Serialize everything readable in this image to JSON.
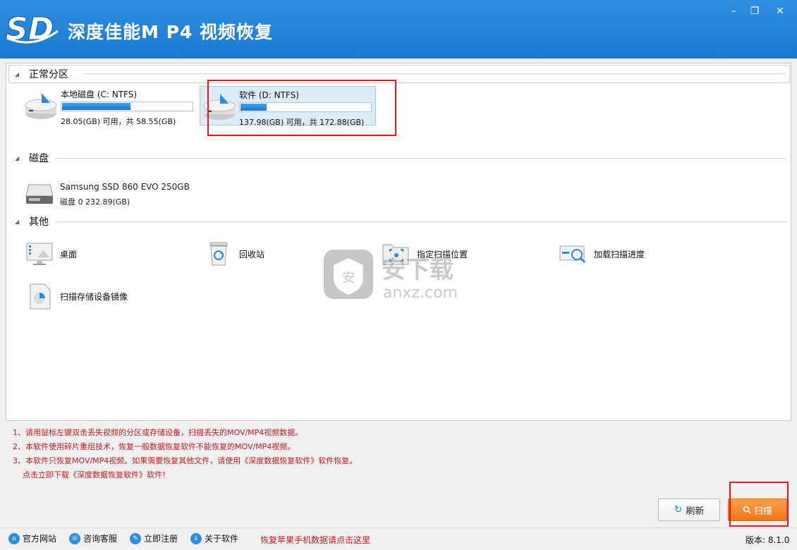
{
  "app": {
    "title": "深度佳能M P4 视频恢复",
    "logo_text": "SD"
  },
  "window_controls": {
    "minimize": "–",
    "restore": "❐",
    "close": "✕"
  },
  "sections": {
    "partitions": {
      "label": "正常分区",
      "items": [
        {
          "name": "本地磁盘 (C: NTFS)",
          "usage": "28.05(GB) 可用，共 58.55(GB)",
          "used_fraction": 0.52,
          "selected": false
        },
        {
          "name": "软件 (D: NTFS)",
          "usage": "137.98(GB) 可用，共 172.88(GB)",
          "used_fraction": 0.2,
          "selected": true
        }
      ]
    },
    "disks": {
      "label": "磁盘",
      "items": [
        {
          "name": "Samsung SSD 860 EVO 250GB",
          "info": "磁盘 0    232.89(GB)"
        }
      ]
    },
    "others": {
      "label": "其他",
      "items": [
        {
          "label": "桌面",
          "icon": "desktop-icon"
        },
        {
          "label": "回收站",
          "icon": "recycle-bin-icon"
        },
        {
          "label": "指定扫描位置",
          "icon": "scan-location-icon"
        },
        {
          "label": "加载扫描进度",
          "icon": "load-progress-icon"
        },
        {
          "label": "扫描存储设备镜像",
          "icon": "disk-image-icon"
        }
      ]
    }
  },
  "watermark": {
    "text": "安下载",
    "subtext": "anxz.com",
    "badge": "安"
  },
  "tips": [
    "1、请用鼠标左键双击丢失视频的分区或存储设备，扫描丢失的MOV/MP4视频数据。",
    "2、本软件使用碎片重组技术，恢复一般数据恢复软件不能恢复的MOV/MP4视频。",
    "3、本软件只恢复MOV/MP4视频。如果需要恢复其他文件，请使用《深度数据恢复软件》软件恢复。",
    "点击立即下载《深度数据恢复软件》软件！"
  ],
  "buttons": {
    "refresh": "刷新",
    "scan": "扫描"
  },
  "statusbar": {
    "items": [
      {
        "label": "官方网站",
        "icon": "home-icon"
      },
      {
        "label": "咨询客服",
        "icon": "support-icon"
      },
      {
        "label": "立即注册",
        "icon": "register-icon"
      },
      {
        "label": "关于软件",
        "icon": "about-icon"
      }
    ],
    "promo": "恢复苹果手机数据请点击这里",
    "version": "版本: 8.1.0"
  },
  "colors": {
    "titlebar": "#1c78d2",
    "accent_orange": "#f07619",
    "tip_red": "#c8181e",
    "highlight_red": "#e3161b"
  }
}
